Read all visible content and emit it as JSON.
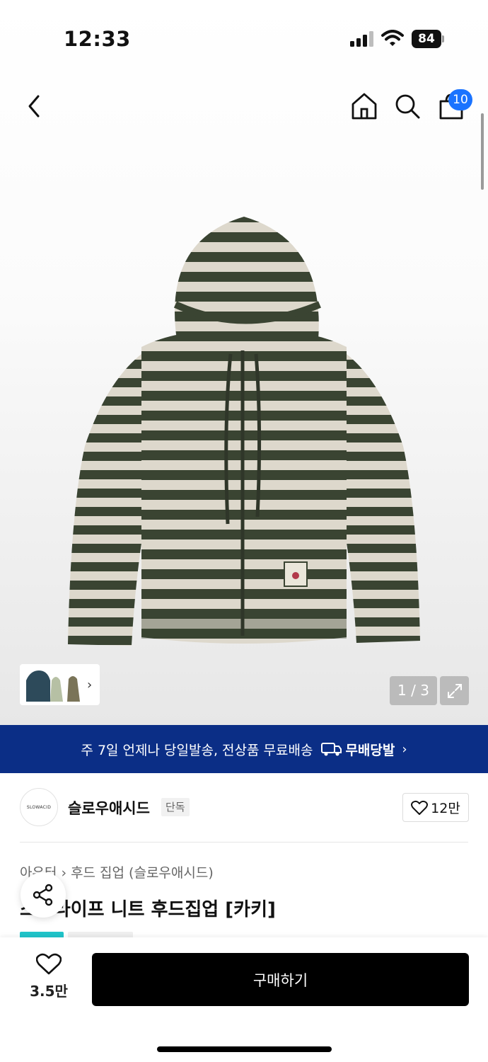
{
  "status": {
    "time": "12:33",
    "battery": "84"
  },
  "nav": {
    "cart_count": "10"
  },
  "gallery": {
    "page_indicator": "1 / 3"
  },
  "banner": {
    "text": "주 7일 언제나 당일발송, 전상품 무료배송",
    "badge": "무배당발"
  },
  "brand": {
    "logo_text": "SLOWACID",
    "name": "슬로우애시드",
    "tag": "단독",
    "likes": "12만"
  },
  "product": {
    "breadcrumb": [
      "아우터",
      "후드 집업 (슬로우애시드)"
    ],
    "title": "스트라이프 니트 후드집업 [카키]"
  },
  "bottom": {
    "wish_count": "3.5만",
    "buy_label": "구매하기"
  },
  "colors": {
    "banner_bg": "#0b2e86",
    "badge_blue": "#1a73ff",
    "buy_bg": "#000000",
    "tag_teal": "#20c4c9",
    "stripe_dark": "#3a4432",
    "stripe_light": "#ddd8cc"
  }
}
